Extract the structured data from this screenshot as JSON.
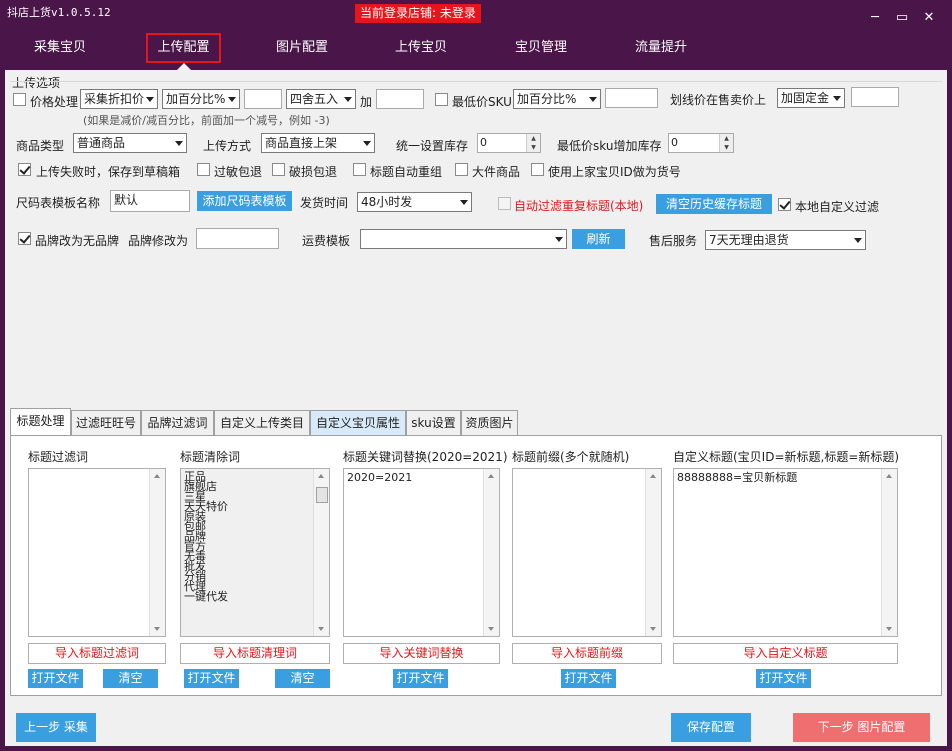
{
  "window": {
    "title": "抖店上货v1.0.5.12",
    "login_status": "当前登录店铺: 未登录",
    "min": "─",
    "max": "▭",
    "close": "✕"
  },
  "nav": {
    "items": [
      "采集宝贝",
      "上传配置",
      "图片配置",
      "上传宝贝",
      "宝贝管理",
      "流量提升"
    ],
    "active": "上传配置"
  },
  "upload": {
    "group_title": "上传选项",
    "price_label": "价格处理",
    "price_source": "采集折扣价",
    "price_mode": "加百分比%",
    "price_value": "",
    "rounding": "四舍五入",
    "plus_label": "加",
    "plus_value": "",
    "min_sku_label": "最低价SKU",
    "min_sku_mode": "加百分比%",
    "min_sku_value": "",
    "strike_label": "划线价在售卖价上",
    "strike_mode": "加固定金",
    "strike_value": "",
    "hint": "(如果是减价/减百分比，前面加一个减号，例如 -3)",
    "product_type_label": "商品类型",
    "product_type": "普通商品",
    "upload_mode_label": "上传方式",
    "upload_mode": "商品直接上架",
    "stock_label": "统一设置库存",
    "stock_value": "0",
    "min_sku_stock_label": "最低价sku增加库存",
    "min_sku_stock_value": "0",
    "fail_draft": "上传失败时，保存到草稿箱",
    "sensitive": "过敏包退",
    "damage": "破损包退",
    "title_regroup": "标题自动重组",
    "bulky": "大件商品",
    "use_id": "使用上家宝贝ID做为货号",
    "size_label": "尺码表模板名称",
    "size_value": "默认",
    "add_size_btn": "添加尺码表模板",
    "ship_label": "发货时间",
    "ship_value": "48小时发",
    "auto_filter": "自动过滤重复标题(本地)",
    "clear_cache_btn": "清空历史缓存标题",
    "local_filter": "本地自定义过滤",
    "brand_none": "品牌改为无品牌",
    "brand_change_label": "品牌修改为",
    "brand_change_value": "",
    "freight_label": "运费模板",
    "freight_value": "",
    "refresh_btn": "刷新",
    "after_sale_label": "售后服务",
    "after_sale_value": "7天无理由退货"
  },
  "tabs": [
    "标题处理",
    "过滤旺旺号",
    "品牌过滤词",
    "自定义上传类目",
    "自定义宝贝属性",
    "sku设置",
    "资质图片"
  ],
  "columns": {
    "filter": {
      "title": "标题过滤词",
      "import": "导入标题过滤词",
      "open": "打开文件",
      "clear": "清空"
    },
    "clean": {
      "title": "标题清除词",
      "items": [
        "正品",
        "旗舰店",
        "三星",
        "天天特价",
        "原装",
        "包邮",
        "品牌",
        "官方",
        "无毒",
        "批发",
        "分销",
        "代理",
        "一键代发"
      ],
      "import": "导入标题清理词",
      "open": "打开文件",
      "clear": "清空"
    },
    "replace": {
      "title": "标题关键词替换(2020=2021)",
      "content": "2020=2021",
      "import": "导入关键词替换",
      "open": "打开文件"
    },
    "prefix": {
      "title": "标题前缀(多个就随机)",
      "import": "导入标题前缀",
      "open": "打开文件"
    },
    "custom": {
      "title": "自定义标题(宝贝ID=新标题,标题=新标题)",
      "content": "88888888=宝贝新标题",
      "import": "导入自定义标题",
      "open": "打开文件"
    }
  },
  "footer": {
    "prev": "上一步 采集",
    "save": "保存配置",
    "next": "下一步 图片配置"
  },
  "colors": {
    "purple": "#4a1548",
    "red": "#e3171b",
    "blue": "#3a9fe0",
    "next": "#ef6f70"
  }
}
